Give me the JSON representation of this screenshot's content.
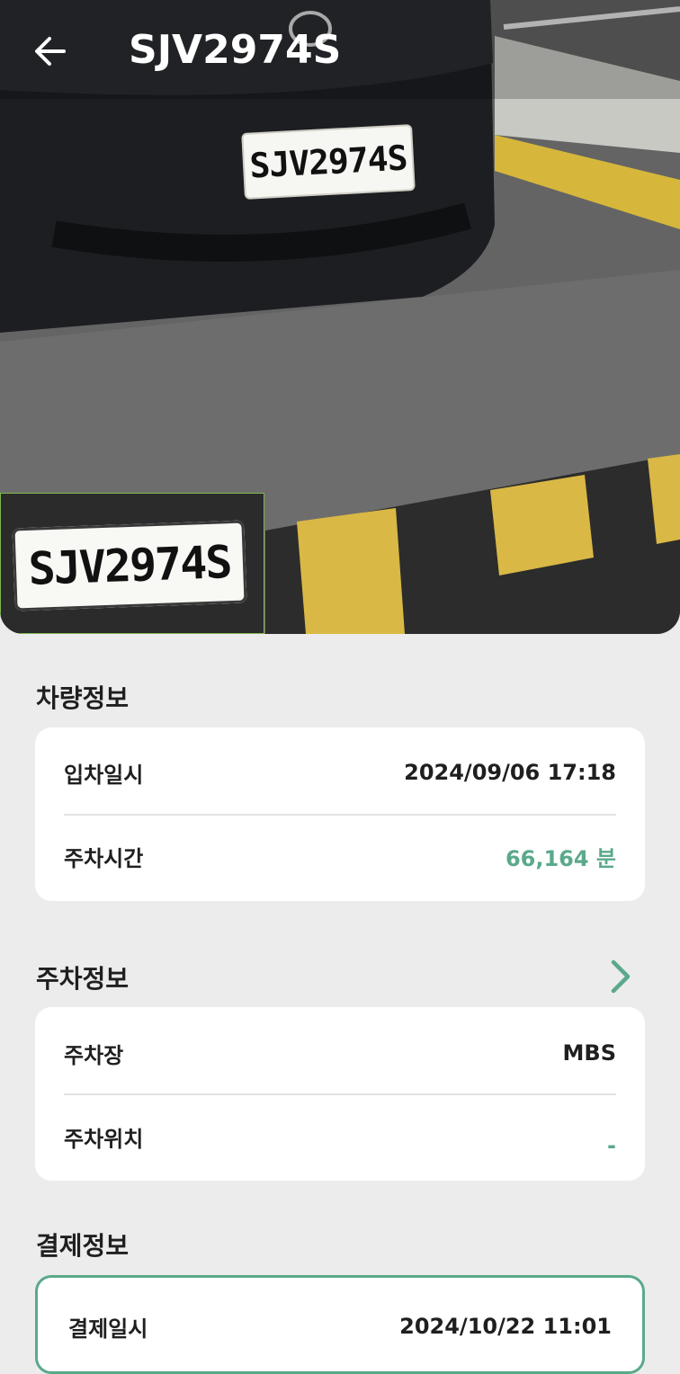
{
  "header": {
    "title": "SJV2974S",
    "back_icon": "arrow-left-icon"
  },
  "photo": {
    "plate_text": "SJV2974S",
    "inset_plate_text": "SJV2974S"
  },
  "vehicle_info": {
    "section_title": "차량정보",
    "rows": [
      {
        "label": "입차일시",
        "value": "2024/09/06 17:18"
      },
      {
        "label": "주차시간",
        "value": "66,164 분"
      }
    ]
  },
  "parking_info": {
    "section_title": "주차정보",
    "chevron_icon": "chevron-right-icon",
    "rows": [
      {
        "label": "주차장",
        "value": "MBS"
      },
      {
        "label": "주차위치",
        "value": "-"
      }
    ]
  },
  "payment_info": {
    "section_title": "결제정보",
    "rows": [
      {
        "label": "결제일시",
        "value": "2024/10/22 11:01"
      }
    ]
  },
  "colors": {
    "accent": "#5aa98a",
    "background": "#ececec",
    "card": "#ffffff"
  }
}
